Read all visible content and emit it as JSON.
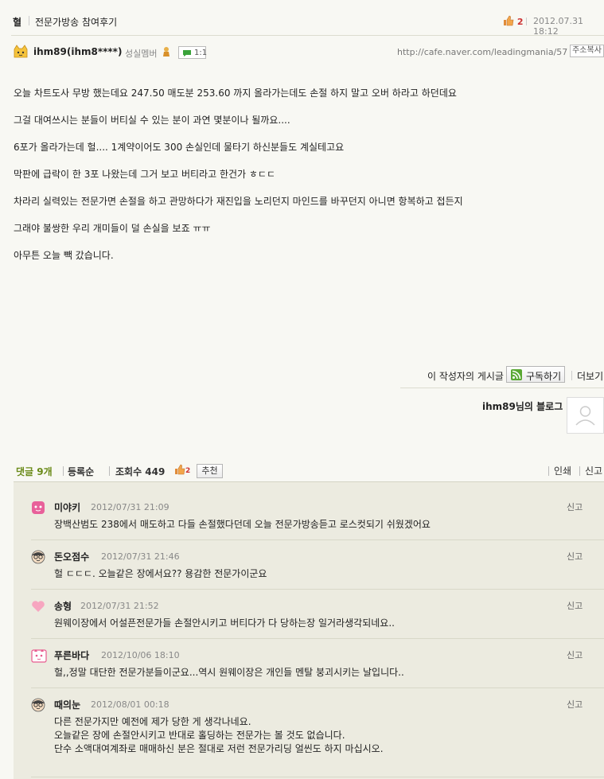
{
  "header": {
    "category": "혈",
    "title": "전문가방송 참여후기",
    "like_count": "2",
    "datetime": "2012.07.31 18:12"
  },
  "author": {
    "name": "ihm89(ihm8****)",
    "grade": "성실멤버",
    "chat_label": "1:1",
    "url": "http://cafe.naver.com/leadingmania/57",
    "copy_label": "주소복사"
  },
  "body": {
    "paragraphs": [
      "오늘 차트도사 무방 했는데요 247.50 매도분 253.60 까지 올라가는데도 손절 하지 말고 오버 하라고 하던데요",
      "그걸 대여쓰시는 분들이 버티실 수 있는 분이 과연 몇분이나 될까요....",
      "6포가 올라가는데 헐.... 1계약이어도 300 손실인데 물타기 하신분들도 계실테고요",
      "막판에 급락이 한 3포 나왔는데 그거 보고 버티라고 한건가 ㅎㄷㄷ",
      "차라리 실력있는 전문가면 손절을 하고 관망하다가 재진입을 노리던지 마인드를 바꾸던지 아니면 항복하고 접든지",
      "그래야 불쌍한 우리 개미들이 덜 손실을 보죠 ㅠㅠ",
      "아무튼 오늘 빽 갔습니다."
    ]
  },
  "writer": {
    "posts_label": "이 작성자의 게시글",
    "subscribe_label": "구독하기",
    "more_label": "더보기",
    "blog_label": "ihm89님의 블로그"
  },
  "comment_bar": {
    "count_label": "댓글 9개",
    "order_label": "등록순",
    "views_label": "조회수 449",
    "like_count": "2",
    "recommend_label": "추천",
    "print_label": "인쇄",
    "report_label": "신고"
  },
  "comments": [
    {
      "name": "미야키",
      "date": "2012/07/31 21:09",
      "text": "장백산범도 238에서 매도하고 다들 손절했다던데 오늘 전문가방송듣고 로스컷되기 쉬웠겠어요",
      "report": "신고",
      "icon": "pink-face-icon"
    },
    {
      "name": "돈오점수",
      "date": "2012/07/31 21:46",
      "text": "헐 ㄷㄷㄷ. 오늘같은 장에서요?? 용감한 전문가이군요",
      "report": "신고",
      "icon": "glasses-face-icon"
    },
    {
      "name": "송형",
      "date": "2012/07/31 21:52",
      "text": "원웨이장에서 어설픈전문가들 손절안시키고 버티다가 다 당하는장 일거라생각되네요..",
      "report": "신고",
      "icon": "heart-icon"
    },
    {
      "name": "푸른바다",
      "date": "2012/10/06 18:10",
      "text": "헐,,정말 대단한 전문가분들이군요...역시 원웨이장은 개인들 멘탈 붕괴시키는 날입니다..",
      "report": "신고",
      "icon": "pink-cat-icon"
    },
    {
      "name": "때의눈",
      "date": "2012/08/01 00:18",
      "text": "다른 전문가지만 예전에 제가 당한 게 생각나네요.\n오늘같은 장에 손절안시키고 반대로 홀딩하는 전문가는 볼 것도 없습니다.\n단수 소액대여계좌로 매매하신 분은 절대로 저런 전문가리딩 얼씬도 하지 마십시오.",
      "report": "신고",
      "icon": "glasses-face-icon"
    }
  ]
}
